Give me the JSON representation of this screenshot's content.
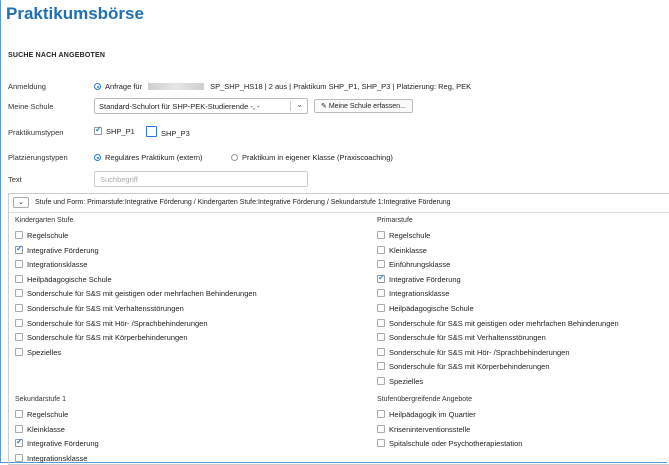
{
  "header": {
    "title": "Praktikumsbörse"
  },
  "section": {
    "title": "SUCHE NACH ANGEBOTEN"
  },
  "anmeldung": {
    "label": "Anmeldung",
    "prefix": "Anfrage für",
    "suffix": "SP_SHP_HS18 | 2 aus | Praktikum SHP_P1, SHP_P3 | Platzierung: Reg, PEK"
  },
  "schule": {
    "label": "Meine Schule",
    "selected": "Standard-Schulort für SHP-PEK-Studierende -, -",
    "button_label": "Meine Schule erfassen..."
  },
  "praktikumstypen": {
    "label": "Praktikumstypen",
    "options": [
      {
        "label": "SHP_P1",
        "checked": true
      },
      {
        "label": "SHP_P3",
        "checked": false
      }
    ]
  },
  "platzierung": {
    "label": "Platzierungstypen",
    "options": [
      {
        "label": "Reguläres Praktikum (extern)",
        "checked": true
      },
      {
        "label": "Praktikum in eigener Klasse (Praxiscoaching)",
        "checked": false
      }
    ]
  },
  "text": {
    "label": "Text",
    "placeholder": "Suchbegriff"
  },
  "stufen": {
    "summary": "Stufe und Form: Primarstufe:Integrative Förderung / Kindergarten Stufe:Integrative Förderung / Sekundarstufe 1:Integrative Förderung",
    "kindergarten": {
      "title": "Kindergarten Stufe",
      "items": [
        {
          "label": "Regelschule",
          "checked": false
        },
        {
          "label": "Integrative Förderung",
          "checked": true
        },
        {
          "label": "Integrationsklasse",
          "checked": false
        },
        {
          "label": "Heilpädagogische Schule",
          "checked": false
        },
        {
          "label": "Sonderschule für S&S mit geistigen oder mehrfachen Behinderungen",
          "checked": false
        },
        {
          "label": "Sonderschule für S&S mit Verhaltensstörungen",
          "checked": false
        },
        {
          "label": "Sonderschule für S&S mit Hör- /Sprachbehinderungen",
          "checked": false
        },
        {
          "label": "Sonderschule für S&S mit Körperbehinderungen",
          "checked": false
        },
        {
          "label": "Spezielles",
          "checked": false
        }
      ]
    },
    "primar": {
      "title": "Primarstufe",
      "items": [
        {
          "label": "Regelschule",
          "checked": false
        },
        {
          "label": "Kleinklasse",
          "checked": false
        },
        {
          "label": "Einführungsklasse",
          "checked": false
        },
        {
          "label": "Integrative Förderung",
          "checked": true
        },
        {
          "label": "Integrationsklasse",
          "checked": false
        },
        {
          "label": "Heilpädagogische Schule",
          "checked": false
        },
        {
          "label": "Sonderschule für S&S mit geistigen oder mehrfachen Behinderungen",
          "checked": false
        },
        {
          "label": "Sonderschule für S&S mit Verhaltensstörungen",
          "checked": false
        },
        {
          "label": "Sonderschule für S&S mit Hör- /Sprachbehinderungen",
          "checked": false
        },
        {
          "label": "Sonderschule für S&S mit Körperbehinderungen",
          "checked": false
        },
        {
          "label": "Spezielles",
          "checked": false
        }
      ]
    },
    "sekundar": {
      "title": "Sekundarstufe 1",
      "items": [
        {
          "label": "Regelschule",
          "checked": false
        },
        {
          "label": "Kleinklasse",
          "checked": false
        },
        {
          "label": "Integrative Förderung",
          "checked": true
        },
        {
          "label": "Integrationsklasse",
          "checked": false
        }
      ]
    },
    "uebergreifend": {
      "title": "Stufenübergreifende Angebote",
      "items": [
        {
          "label": "Heilpädagogik im Quartier",
          "checked": false
        },
        {
          "label": "Kriseninterventionsstelle",
          "checked": false
        },
        {
          "label": "Spitalschule oder Psychotherapiestation",
          "checked": false
        }
      ]
    }
  }
}
